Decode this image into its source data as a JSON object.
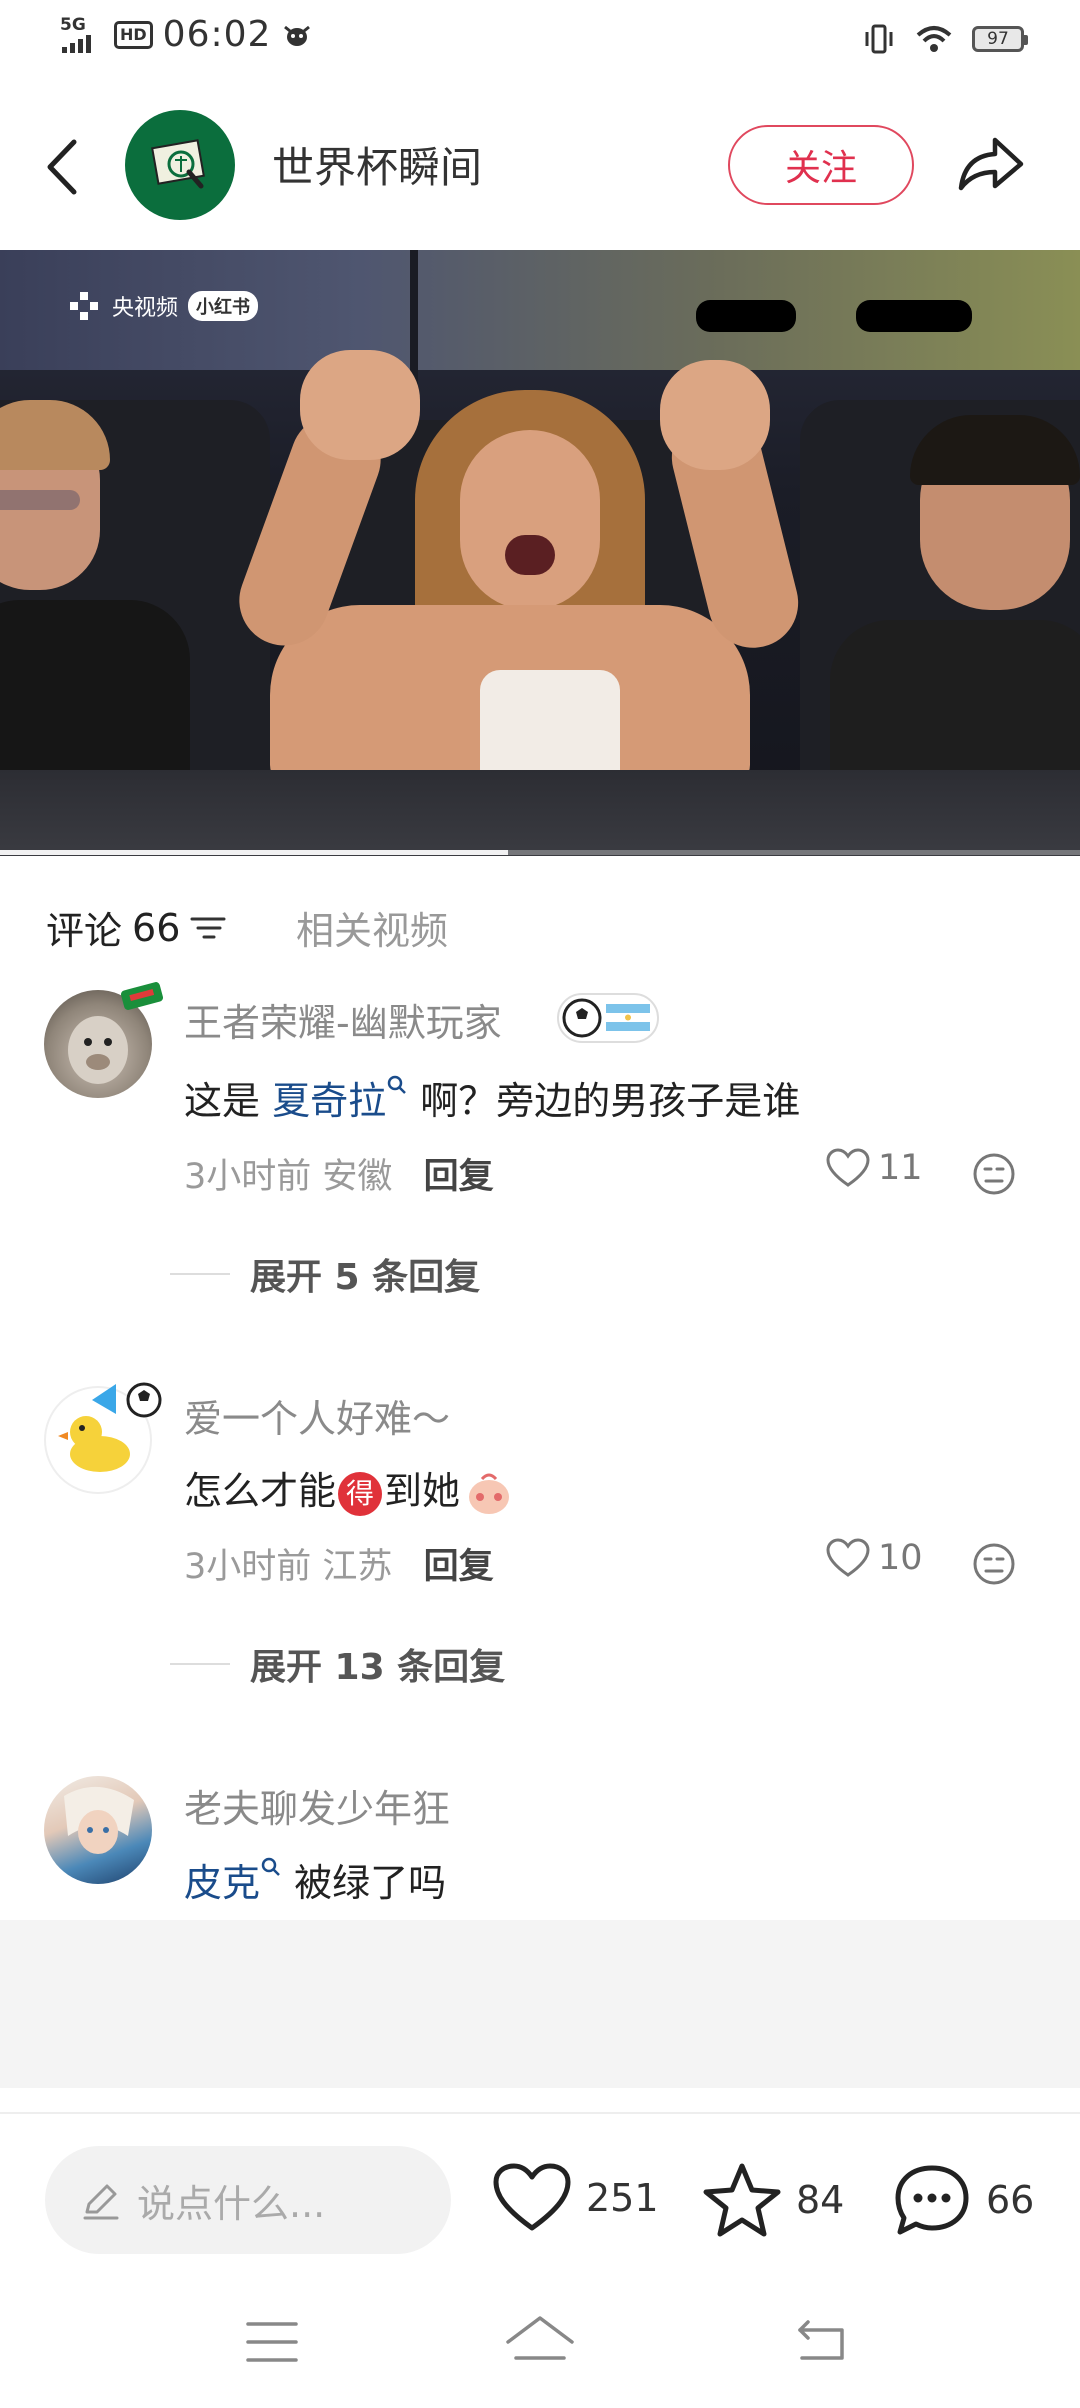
{
  "status_bar": {
    "network": "5G",
    "hd": "HD",
    "time": "06:02",
    "battery": "97"
  },
  "header": {
    "channel_name": "世界杯瞬间",
    "follow_label": "关注"
  },
  "video": {
    "watermark_cctv": "央视频",
    "watermark_xhs": "小红书",
    "progress": 0.47
  },
  "tabs": {
    "comments_label": "评论",
    "comments_count": "66",
    "related_label": "相关视频"
  },
  "comments": [
    {
      "username": "王者荣耀-幽默玩家",
      "text_mention": "夏奇拉",
      "text_prefix": "这是 ",
      "text_rest": " 啊？旁边的男孩子是谁",
      "time": "3小时前",
      "location": "安徽",
      "reply_label": "回复",
      "likes": "11",
      "expand_label": "展开 5 条回复"
    },
    {
      "username": "爱一个人好难～",
      "text_a": "怎么才能",
      "text_emoji": "得",
      "text_b": "到她",
      "time": "3小时前",
      "location": "江苏",
      "reply_label": "回复",
      "likes": "10",
      "expand_label": "展开 13 条回复"
    },
    {
      "username": "老夫聊发少年狂",
      "text_mention": "皮克",
      "text_rest": " 被绿了吗"
    }
  ],
  "bottom_bar": {
    "input_placeholder": "说点什么...",
    "likes": "251",
    "stars": "84",
    "comments": "66"
  },
  "colors": {
    "accent": "#e0304e",
    "mention": "#1a4c8b",
    "channel_green": "#0b6e3d"
  }
}
